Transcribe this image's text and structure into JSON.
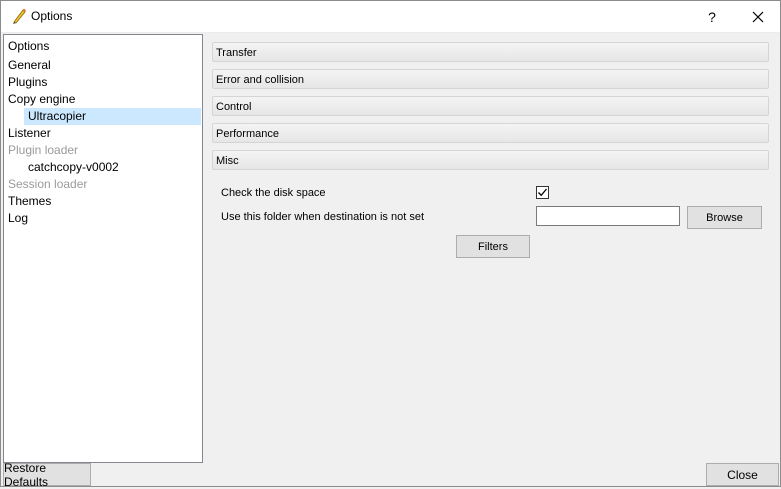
{
  "window": {
    "title": "Options",
    "help_label": "?",
    "close_label": "✕"
  },
  "tree": {
    "items": [
      {
        "label": "Options",
        "level": 0,
        "state": "normal"
      },
      {
        "label": "General",
        "level": 0,
        "state": "normal"
      },
      {
        "label": "Plugins",
        "level": 0,
        "state": "normal"
      },
      {
        "label": "Copy engine",
        "level": 0,
        "state": "normal"
      },
      {
        "label": "Ultracopier",
        "level": 1,
        "state": "selected"
      },
      {
        "label": "Listener",
        "level": 0,
        "state": "normal"
      },
      {
        "label": "Plugin loader",
        "level": 0,
        "state": "disabled"
      },
      {
        "label": "catchcopy-v0002",
        "level": 1,
        "state": "normal"
      },
      {
        "label": "Session loader",
        "level": 0,
        "state": "disabled"
      },
      {
        "label": "Themes",
        "level": 0,
        "state": "normal"
      },
      {
        "label": "Log",
        "level": 0,
        "state": "normal"
      }
    ]
  },
  "sections": [
    {
      "label": "Transfer"
    },
    {
      "label": "Error and collision"
    },
    {
      "label": "Control"
    },
    {
      "label": "Performance"
    },
    {
      "label": "Misc"
    }
  ],
  "misc": {
    "check_disk_label": "Check the disk space",
    "check_disk_checked": true,
    "folder_label": "Use this folder when destination is not set",
    "folder_value": "",
    "browse_label": "Browse",
    "filters_label": "Filters"
  },
  "footer": {
    "restore_label": "Restore Defaults",
    "close_label": "Close"
  },
  "colors": {
    "selected_bg": "#cce8ff",
    "disabled_text": "#9a9a9a"
  }
}
